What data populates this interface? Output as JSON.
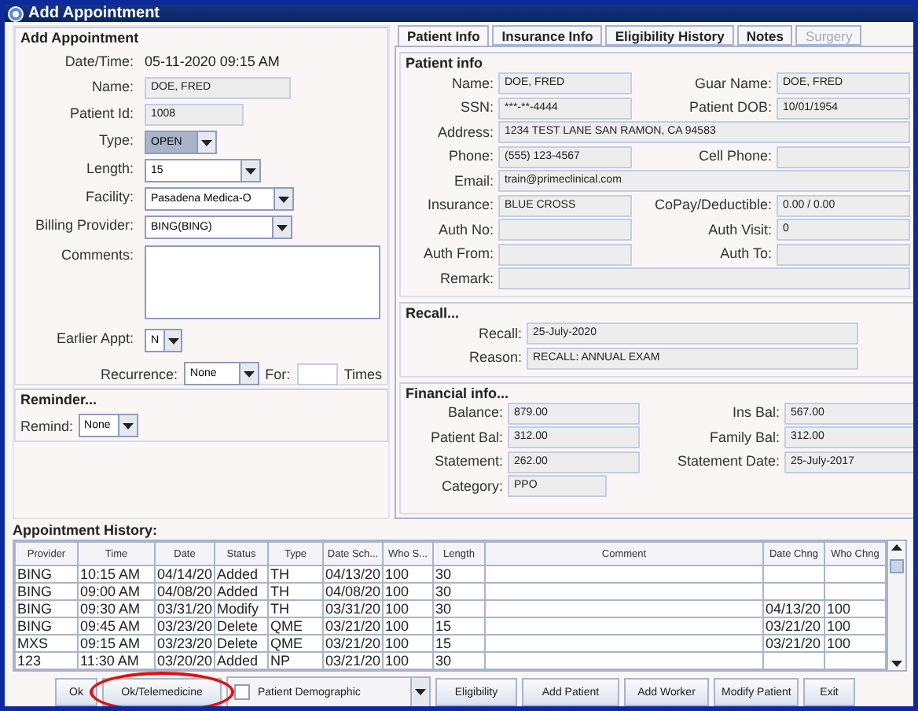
{
  "window": {
    "title": "Add Appointment"
  },
  "appointment": {
    "title": "Add Appointment",
    "fields": [
      {
        "kind": "text",
        "label": "Date/Time:",
        "value": "05-11-2020 09:15 AM"
      },
      {
        "kind": "field",
        "label": "Name:",
        "value": "DOE, FRED"
      },
      {
        "kind": "field",
        "label": "Patient Id:",
        "value": "1008"
      },
      {
        "kind": "dropdown",
        "label": "Type:",
        "value": "OPEN",
        "focused": true
      },
      {
        "kind": "dropdown",
        "label": "Length:",
        "value": "15",
        "focused": false
      },
      {
        "kind": "dropdown",
        "label": "Facility:",
        "value": "Pasadena Medica-O",
        "focused": false
      },
      {
        "kind": "dropdown",
        "label": "Billing Provider:",
        "value": "BING(BING)",
        "focused": false
      },
      {
        "kind": "textarea",
        "label": "Comments:"
      },
      {
        "kind": "dropdown",
        "label": "Earlier Appt:",
        "value": "N",
        "focused": false
      }
    ],
    "recurrence": {
      "label": "Recurrence:",
      "value": "None",
      "for_label": "For:",
      "times_label": "Times"
    }
  },
  "reminder": {
    "title": "Reminder...",
    "label": "Remind:",
    "value": "None"
  },
  "tabs": [
    {
      "label": "Patient Info",
      "selected": true,
      "disabled": false
    },
    {
      "label": "Insurance Info",
      "selected": false,
      "disabled": false
    },
    {
      "label": "Eligibility History",
      "selected": false,
      "disabled": false
    },
    {
      "label": "Notes",
      "selected": false,
      "disabled": false
    },
    {
      "label": "Surgery",
      "selected": false,
      "disabled": true
    }
  ],
  "patient_info": {
    "title": "Patient info",
    "fields": [
      {
        "kind": "half",
        "label": "Name:",
        "value": "DOE, FRED"
      },
      {
        "kind": "half",
        "label": "Guar Name:",
        "value": "DOE, FRED"
      },
      {
        "kind": "half",
        "label": "SSN:",
        "value": "***-**-4444"
      },
      {
        "kind": "half",
        "label": "Patient DOB:",
        "value": "10/01/1954"
      },
      {
        "kind": "wide",
        "label": "Address:",
        "value": "1234 TEST LANE SAN RAMON, CA 94583"
      },
      {
        "kind": "half",
        "label": "Phone:",
        "value": "(555) 123-4567"
      },
      {
        "kind": "half",
        "label": "Cell Phone:"
      },
      {
        "kind": "wide",
        "label": "Email:",
        "value": "train@primeclinical.com"
      },
      {
        "kind": "half",
        "label": "Insurance:",
        "value": "BLUE CROSS"
      },
      {
        "kind": "half",
        "label": "CoPay/Deductible:",
        "value": "0.00  /  0.00"
      },
      {
        "kind": "half",
        "label": "Auth No:"
      },
      {
        "kind": "half",
        "label": "Auth Visit:",
        "value": "0"
      },
      {
        "kind": "half",
        "label": "Auth From:"
      },
      {
        "kind": "half",
        "label": "Auth To:"
      },
      {
        "kind": "wide",
        "label": "Remark:"
      }
    ]
  },
  "recall": {
    "title": "Recall...",
    "fields": [
      {
        "label": "Recall:",
        "value": "25-July-2020"
      },
      {
        "label": "Reason:",
        "value": "RECALL: ANNUAL EXAM"
      }
    ]
  },
  "financial": {
    "title": "Financial info...",
    "fields": [
      {
        "kind": "half",
        "label": "Balance:",
        "value": "879.00"
      },
      {
        "kind": "half",
        "label": "Ins Bal:",
        "value": "567.00"
      },
      {
        "kind": "half",
        "label": "Patient Bal:",
        "value": "312.00"
      },
      {
        "kind": "half",
        "label": "Family Bal:",
        "value": "312.00"
      },
      {
        "kind": "half",
        "label": "Statement:",
        "value": "262.00"
      },
      {
        "kind": "half",
        "label": "Statement Date:",
        "value": "25-July-2017"
      },
      {
        "kind": "short",
        "label": "Category:",
        "value": "PPO"
      }
    ]
  },
  "appointment_history": {
    "title": "Appointment History:",
    "columns": [
      "Provider",
      "Time",
      "Date",
      "Status",
      "Type",
      "Date Sch...",
      "Who S...",
      "Length",
      "Comment",
      "Date Chng",
      "Who Chng"
    ],
    "rows": [
      [
        "BING",
        "10:15 AM",
        "04/14/20",
        "Added",
        "TH",
        "04/13/20",
        "100",
        "30",
        null,
        null,
        null
      ],
      [
        "BING",
        "09:00 AM",
        "04/08/20",
        "Added",
        "TH",
        "04/08/20",
        "100",
        "30",
        null,
        null,
        null
      ],
      [
        "BING",
        "09:30 AM",
        "03/31/20",
        "Modify",
        "TH",
        "03/31/20",
        "100",
        "30",
        null,
        "04/13/20",
        "100"
      ],
      [
        "BING",
        "09:45 AM",
        "03/23/20",
        "Delete",
        "QME",
        "03/21/20",
        "100",
        "15",
        null,
        "03/21/20",
        "100"
      ],
      [
        "MXS",
        "09:15 AM",
        "03/23/20",
        "Delete",
        "QME",
        "03/21/20",
        "100",
        "15",
        null,
        "03/21/20",
        "100"
      ],
      [
        "123",
        "11:30 AM",
        "03/20/20",
        "Added",
        "NP",
        "03/21/20",
        "100",
        "30",
        null,
        null,
        null
      ]
    ]
  },
  "buttons": [
    {
      "kind": "button",
      "label": "Ok",
      "highlighted": false
    },
    {
      "kind": "button",
      "label": "Ok/Telemedicine",
      "highlighted": true
    },
    {
      "kind": "checkcombo",
      "label": "Patient Demographic",
      "checked": false
    },
    {
      "kind": "button",
      "label": "Eligibility",
      "highlighted": false
    },
    {
      "kind": "button",
      "label": "Add Patient",
      "highlighted": false
    },
    {
      "kind": "button",
      "label": "Add Worker",
      "highlighted": false
    },
    {
      "kind": "button",
      "label": "Modify Patient",
      "highlighted": false
    },
    {
      "kind": "button",
      "label": "Exit",
      "highlighted": false
    }
  ]
}
